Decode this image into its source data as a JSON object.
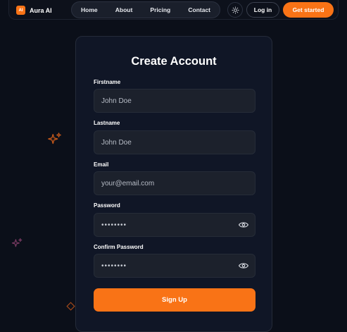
{
  "brand": {
    "badge": "AI",
    "name": "Aura AI"
  },
  "nav": {
    "links": [
      "Home",
      "About",
      "Pricing",
      "Contact"
    ]
  },
  "header": {
    "login_label": "Log in",
    "cta_label": "Get started"
  },
  "form": {
    "title": "Create Account",
    "fields": [
      {
        "label": "Firstname",
        "placeholder": "John Doe"
      },
      {
        "label": "Lastname",
        "placeholder": "John Doe"
      },
      {
        "label": "Email",
        "placeholder": "your@email.com"
      },
      {
        "label": "Password",
        "value": "••••••••"
      },
      {
        "label": "Confirm Password",
        "value": "••••••••"
      }
    ],
    "submit_label": "Sign Up"
  },
  "colors": {
    "accent": "#f97316",
    "background": "#0b0f19",
    "card": "#101626",
    "input": "#1c212c"
  },
  "icons": [
    "sun-icon",
    "eye-icon",
    "sparkle-icon",
    "diamond-icon"
  ]
}
